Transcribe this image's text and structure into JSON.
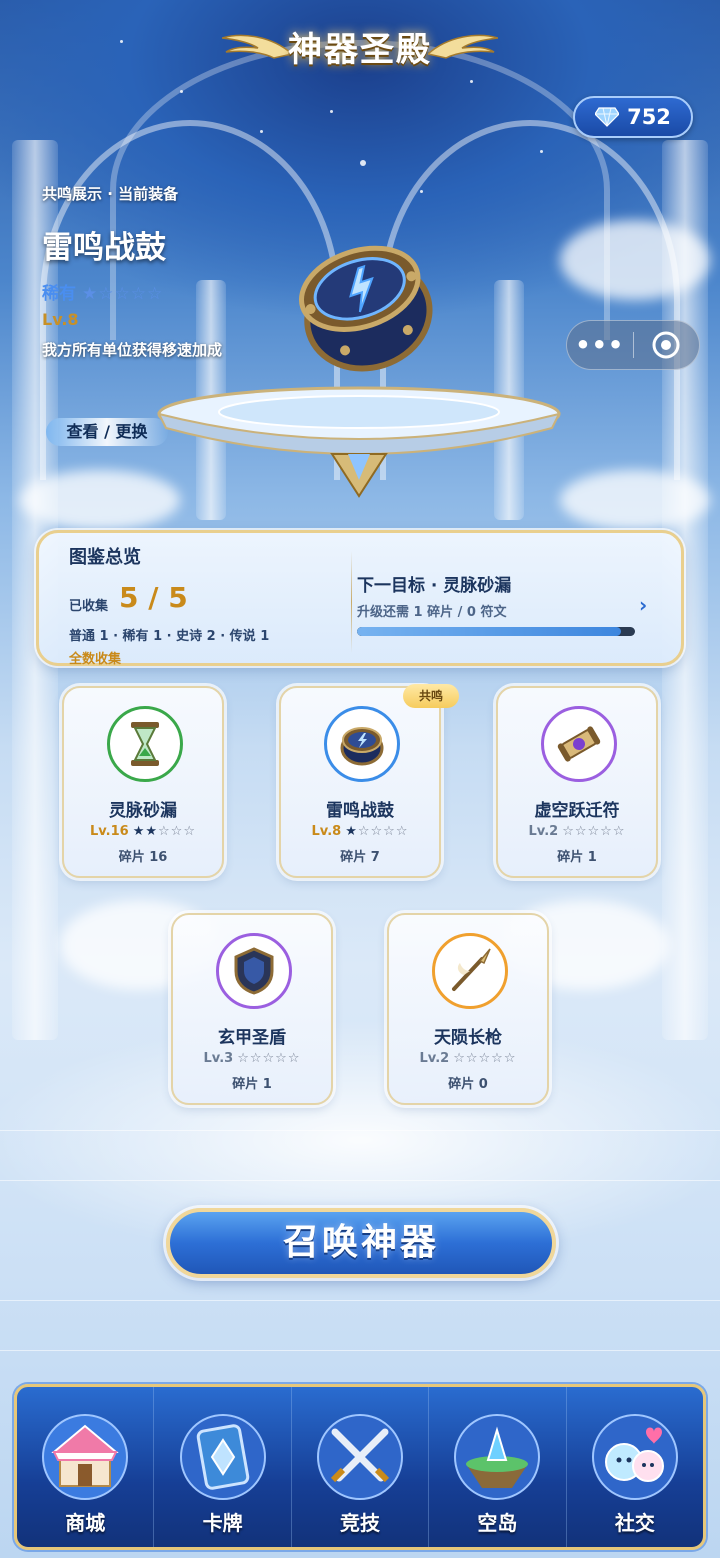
{
  "header": {
    "title": "神器圣殿"
  },
  "currency": {
    "gems": "752"
  },
  "capsule": {
    "more": "•••"
  },
  "featured": {
    "label": "共鸣展示 · 当前装备",
    "name": "雷鸣战鼓",
    "rarity": "稀有",
    "stars": "★☆☆☆☆",
    "level": "Lv.8",
    "description": "我方所有单位获得移速加成",
    "view_button": "查看 / 更换"
  },
  "collection": {
    "title": "图鉴总览",
    "collected_label": "已收集",
    "collected_value": "5 / 5",
    "breakdown": "普通 1 · 稀有 1 · 史诗 2 · 传说 1",
    "all_collected": "全数收集",
    "next_target": "下一目标 · 灵脉砂漏",
    "requirement": "升级还需 1 碎片 / 0 符文",
    "progress": 0.95
  },
  "artifacts": [
    {
      "name": "灵脉砂漏",
      "level": "Lv.16",
      "stars_filled": "★★",
      "stars_empty": "☆☆☆",
      "fragments": "碎片 16",
      "ring": "#3aa84a",
      "icon": "hourglass-icon"
    },
    {
      "name": "雷鸣战鼓",
      "level": "Lv.8",
      "stars_filled": "★",
      "stars_empty": "☆☆☆☆",
      "fragments": "碎片 7",
      "ring": "#3b8de8",
      "icon": "drum-icon",
      "badge": "共鸣"
    },
    {
      "name": "虚空跃迁符",
      "level": "Lv.2",
      "stars_filled": "",
      "stars_empty": "☆☆☆☆☆",
      "fragments": "碎片 1",
      "ring": "#9b5fe0",
      "icon": "scroll-icon"
    },
    {
      "name": "玄甲圣盾",
      "level": "Lv.3",
      "stars_filled": "",
      "stars_empty": "☆☆☆☆☆",
      "fragments": "碎片 1",
      "ring": "#9b5fe0",
      "icon": "shield-icon"
    },
    {
      "name": "天陨长枪",
      "level": "Lv.2",
      "stars_filled": "",
      "stars_empty": "☆☆☆☆☆",
      "fragments": "碎片 0",
      "ring": "#f0a02e",
      "icon": "spear-icon"
    }
  ],
  "summon_button": "召唤神器",
  "nav": [
    {
      "label": "商城",
      "icon": "shop-icon"
    },
    {
      "label": "卡牌",
      "icon": "card-icon"
    },
    {
      "label": "竞技",
      "icon": "crossed-swords-icon"
    },
    {
      "label": "空岛",
      "icon": "sky-island-icon"
    },
    {
      "label": "社交",
      "icon": "social-icon"
    }
  ],
  "colors": {
    "gold": "#c98a1a",
    "navy": "#1c355e",
    "accent_blue": "#2d6fd6"
  }
}
